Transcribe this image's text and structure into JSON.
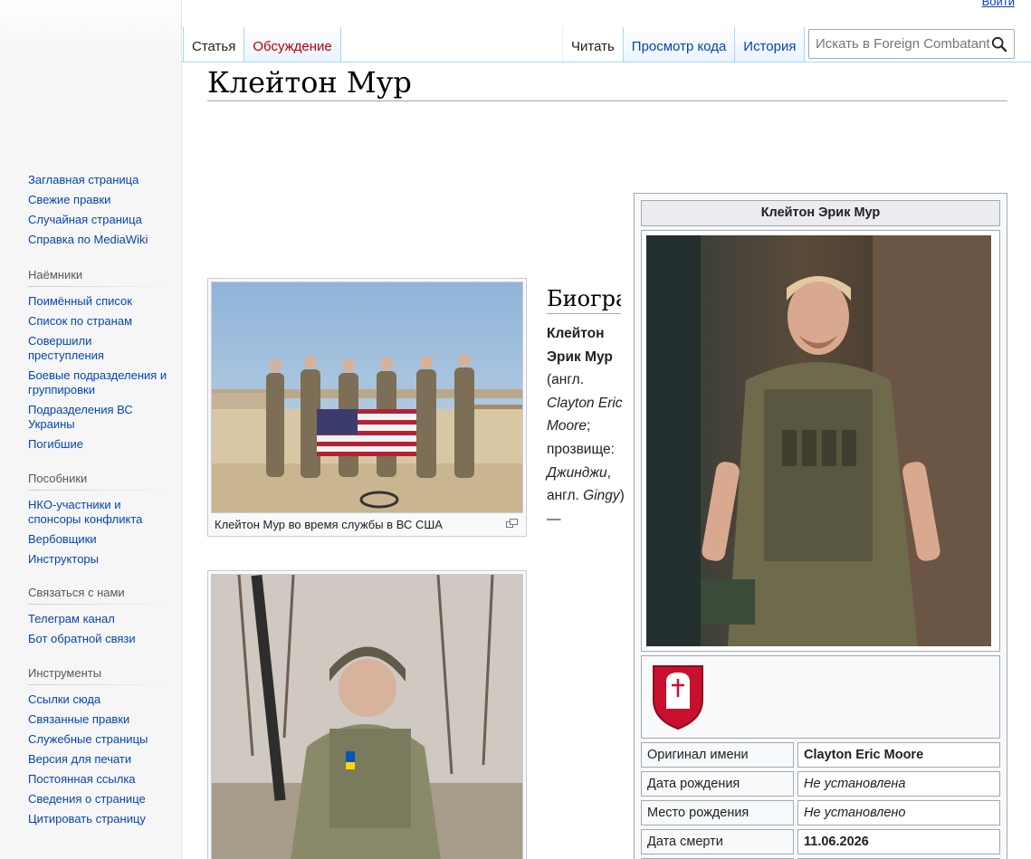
{
  "header": {
    "login": "Войти",
    "tabs_left": [
      "Статья",
      "Обсуждение"
    ],
    "tabs_right": [
      "Читать",
      "Просмотр кода",
      "История"
    ],
    "search_placeholder": "Искать в Foreign Combatant"
  },
  "sidebar": {
    "navigation": [
      "Заглавная страница",
      "Свежие правки",
      "Случайная страница",
      "Справка по MediaWiki"
    ],
    "mercenaries": {
      "heading": "Наёмники",
      "items": [
        "Поимённый список",
        "Список по странам",
        "Совершили преступления",
        "Боевые подразделения и группировки",
        "Подразделения ВС Украины",
        "Погибшие"
      ]
    },
    "accomplices": {
      "heading": "Пособники",
      "items": [
        "НКО-участники и спонсоры конфликта",
        "Вербовщики",
        "Инструкторы"
      ]
    },
    "contact": {
      "heading": "Связаться с нами",
      "items": [
        "Телеграм канал",
        "Бот обратной связи"
      ]
    },
    "tools": {
      "heading": "Инструменты",
      "items": [
        "Ссылки сюда",
        "Связанные правки",
        "Служебные страницы",
        "Версия для печати",
        "Постоянная ссылка",
        "Сведения о странице",
        "Цитировать страницу"
      ]
    }
  },
  "article": {
    "title": "Клейтон Мур",
    "thumb1_caption": "Клейтон Мур во время службы в ВС США",
    "section_heading": "Биография",
    "bio": {
      "name_bold": "Клейтон Эрик Мур",
      "lang1": "(англ.",
      "latin_name": "Clayton Eric Moore",
      "nick_label": "; прозвище:",
      "nick": "Джинджи",
      "lang2": ", англ.",
      "nick_latin": "Gingy",
      "tail": ") —"
    }
  },
  "infobox": {
    "title": "Клейтон Эрик Мур",
    "rows": [
      {
        "label": "Оригинал имени",
        "value": "Clayton Eric Moore"
      },
      {
        "label": "Дата рождения",
        "value": "Не установлена"
      },
      {
        "label": "Место рождения",
        "value": "Не установлено"
      },
      {
        "label": "Дата смерти",
        "value": "11.06.2026"
      }
    ]
  },
  "colors": {
    "link": "#0645ad",
    "redlink": "#ba0000",
    "emblem": "#c8102e"
  }
}
